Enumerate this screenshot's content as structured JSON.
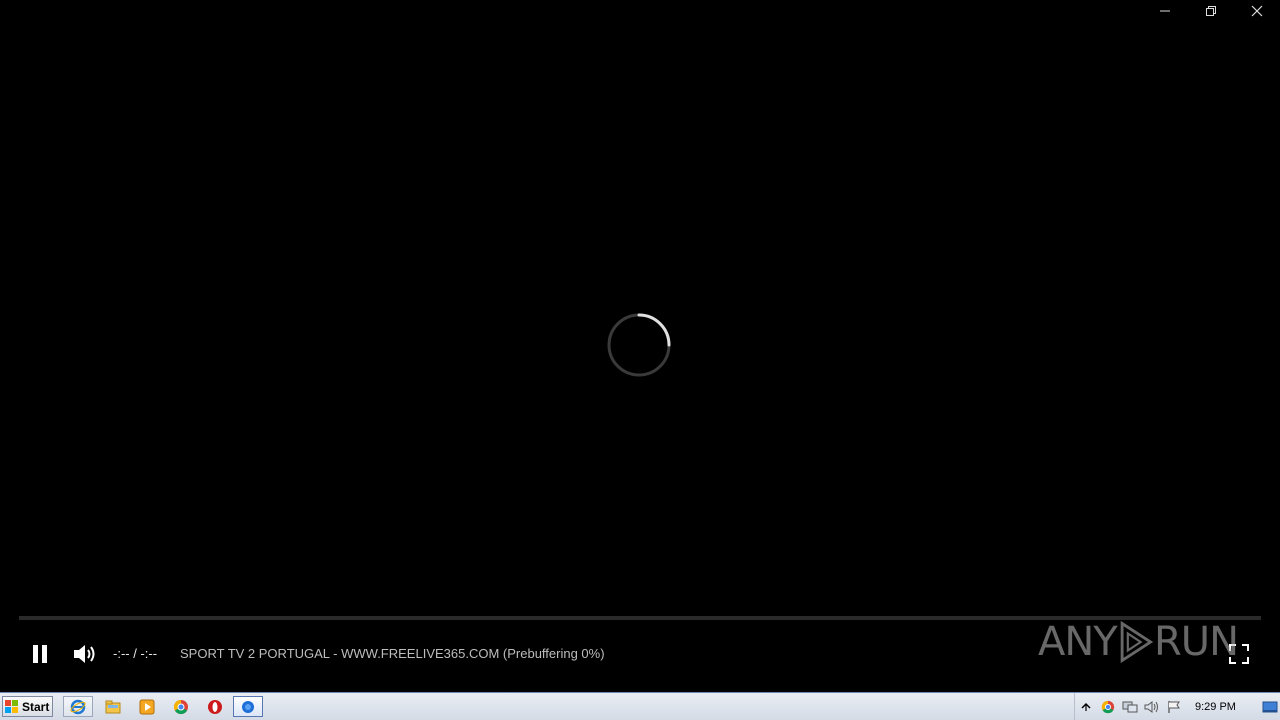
{
  "window": {
    "controls": [
      "minimize",
      "restore",
      "close"
    ]
  },
  "player": {
    "state": "buffering",
    "seek_progress": 0,
    "time_display": "-:-- / -:--",
    "stream_title": "SPORT TV 2 PORTUGAL - WWW.FREELIVE365.COM (Prebuffering 0%)",
    "icons": {
      "pause": "pause-icon",
      "volume": "volume-icon",
      "fullscreen": "fullscreen-icon",
      "spinner": "loading-spinner"
    }
  },
  "watermark": {
    "text_left": "ANY",
    "text_right": "RUN"
  },
  "taskbar": {
    "start_label": "Start",
    "pinned": [
      "internet-explorer-icon",
      "file-explorer-icon",
      "media-player-icon",
      "chrome-icon",
      "opera-icon",
      "active-app-icon"
    ],
    "tray_icons": [
      "show-hidden-icon",
      "chrome-tray-icon",
      "network-icon",
      "speaker-icon",
      "action-center-flag-icon"
    ],
    "clock": "9:29 PM"
  },
  "colors": {
    "background": "#000000",
    "text_primary": "#e6e6e6",
    "text_secondary": "#bdbdbd",
    "taskbar_top": "#e9edf3",
    "taskbar_bottom": "#d4dbe6"
  }
}
